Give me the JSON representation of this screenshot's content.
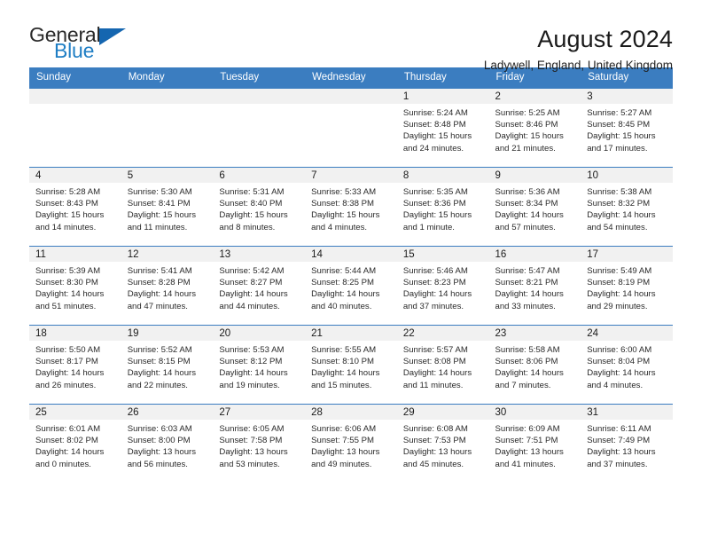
{
  "brand": {
    "name_part1": "General",
    "name_part2": "Blue",
    "accent_color": "#1f7ec4",
    "triangle_color": "#1566b0"
  },
  "header": {
    "title": "August 2024",
    "subtitle": "Ladywell, England, United Kingdom"
  },
  "calendar": {
    "header_bg": "#3b7dc0",
    "daynum_bg": "#f1f1f1",
    "weekdays": [
      "Sunday",
      "Monday",
      "Tuesday",
      "Wednesday",
      "Thursday",
      "Friday",
      "Saturday"
    ],
    "weeks": [
      [
        {
          "day": "",
          "empty": true
        },
        {
          "day": "",
          "empty": true
        },
        {
          "day": "",
          "empty": true
        },
        {
          "day": "",
          "empty": true
        },
        {
          "day": "1",
          "sunrise": "Sunrise: 5:24 AM",
          "sunset": "Sunset: 8:48 PM",
          "daylight": "Daylight: 15 hours and 24 minutes."
        },
        {
          "day": "2",
          "sunrise": "Sunrise: 5:25 AM",
          "sunset": "Sunset: 8:46 PM",
          "daylight": "Daylight: 15 hours and 21 minutes."
        },
        {
          "day": "3",
          "sunrise": "Sunrise: 5:27 AM",
          "sunset": "Sunset: 8:45 PM",
          "daylight": "Daylight: 15 hours and 17 minutes."
        }
      ],
      [
        {
          "day": "4",
          "sunrise": "Sunrise: 5:28 AM",
          "sunset": "Sunset: 8:43 PM",
          "daylight": "Daylight: 15 hours and 14 minutes."
        },
        {
          "day": "5",
          "sunrise": "Sunrise: 5:30 AM",
          "sunset": "Sunset: 8:41 PM",
          "daylight": "Daylight: 15 hours and 11 minutes."
        },
        {
          "day": "6",
          "sunrise": "Sunrise: 5:31 AM",
          "sunset": "Sunset: 8:40 PM",
          "daylight": "Daylight: 15 hours and 8 minutes."
        },
        {
          "day": "7",
          "sunrise": "Sunrise: 5:33 AM",
          "sunset": "Sunset: 8:38 PM",
          "daylight": "Daylight: 15 hours and 4 minutes."
        },
        {
          "day": "8",
          "sunrise": "Sunrise: 5:35 AM",
          "sunset": "Sunset: 8:36 PM",
          "daylight": "Daylight: 15 hours and 1 minute."
        },
        {
          "day": "9",
          "sunrise": "Sunrise: 5:36 AM",
          "sunset": "Sunset: 8:34 PM",
          "daylight": "Daylight: 14 hours and 57 minutes."
        },
        {
          "day": "10",
          "sunrise": "Sunrise: 5:38 AM",
          "sunset": "Sunset: 8:32 PM",
          "daylight": "Daylight: 14 hours and 54 minutes."
        }
      ],
      [
        {
          "day": "11",
          "sunrise": "Sunrise: 5:39 AM",
          "sunset": "Sunset: 8:30 PM",
          "daylight": "Daylight: 14 hours and 51 minutes."
        },
        {
          "day": "12",
          "sunrise": "Sunrise: 5:41 AM",
          "sunset": "Sunset: 8:28 PM",
          "daylight": "Daylight: 14 hours and 47 minutes."
        },
        {
          "day": "13",
          "sunrise": "Sunrise: 5:42 AM",
          "sunset": "Sunset: 8:27 PM",
          "daylight": "Daylight: 14 hours and 44 minutes."
        },
        {
          "day": "14",
          "sunrise": "Sunrise: 5:44 AM",
          "sunset": "Sunset: 8:25 PM",
          "daylight": "Daylight: 14 hours and 40 minutes."
        },
        {
          "day": "15",
          "sunrise": "Sunrise: 5:46 AM",
          "sunset": "Sunset: 8:23 PM",
          "daylight": "Daylight: 14 hours and 37 minutes."
        },
        {
          "day": "16",
          "sunrise": "Sunrise: 5:47 AM",
          "sunset": "Sunset: 8:21 PM",
          "daylight": "Daylight: 14 hours and 33 minutes."
        },
        {
          "day": "17",
          "sunrise": "Sunrise: 5:49 AM",
          "sunset": "Sunset: 8:19 PM",
          "daylight": "Daylight: 14 hours and 29 minutes."
        }
      ],
      [
        {
          "day": "18",
          "sunrise": "Sunrise: 5:50 AM",
          "sunset": "Sunset: 8:17 PM",
          "daylight": "Daylight: 14 hours and 26 minutes."
        },
        {
          "day": "19",
          "sunrise": "Sunrise: 5:52 AM",
          "sunset": "Sunset: 8:15 PM",
          "daylight": "Daylight: 14 hours and 22 minutes."
        },
        {
          "day": "20",
          "sunrise": "Sunrise: 5:53 AM",
          "sunset": "Sunset: 8:12 PM",
          "daylight": "Daylight: 14 hours and 19 minutes."
        },
        {
          "day": "21",
          "sunrise": "Sunrise: 5:55 AM",
          "sunset": "Sunset: 8:10 PM",
          "daylight": "Daylight: 14 hours and 15 minutes."
        },
        {
          "day": "22",
          "sunrise": "Sunrise: 5:57 AM",
          "sunset": "Sunset: 8:08 PM",
          "daylight": "Daylight: 14 hours and 11 minutes."
        },
        {
          "day": "23",
          "sunrise": "Sunrise: 5:58 AM",
          "sunset": "Sunset: 8:06 PM",
          "daylight": "Daylight: 14 hours and 7 minutes."
        },
        {
          "day": "24",
          "sunrise": "Sunrise: 6:00 AM",
          "sunset": "Sunset: 8:04 PM",
          "daylight": "Daylight: 14 hours and 4 minutes."
        }
      ],
      [
        {
          "day": "25",
          "sunrise": "Sunrise: 6:01 AM",
          "sunset": "Sunset: 8:02 PM",
          "daylight": "Daylight: 14 hours and 0 minutes."
        },
        {
          "day": "26",
          "sunrise": "Sunrise: 6:03 AM",
          "sunset": "Sunset: 8:00 PM",
          "daylight": "Daylight: 13 hours and 56 minutes."
        },
        {
          "day": "27",
          "sunrise": "Sunrise: 6:05 AM",
          "sunset": "Sunset: 7:58 PM",
          "daylight": "Daylight: 13 hours and 53 minutes."
        },
        {
          "day": "28",
          "sunrise": "Sunrise: 6:06 AM",
          "sunset": "Sunset: 7:55 PM",
          "daylight": "Daylight: 13 hours and 49 minutes."
        },
        {
          "day": "29",
          "sunrise": "Sunrise: 6:08 AM",
          "sunset": "Sunset: 7:53 PM",
          "daylight": "Daylight: 13 hours and 45 minutes."
        },
        {
          "day": "30",
          "sunrise": "Sunrise: 6:09 AM",
          "sunset": "Sunset: 7:51 PM",
          "daylight": "Daylight: 13 hours and 41 minutes."
        },
        {
          "day": "31",
          "sunrise": "Sunrise: 6:11 AM",
          "sunset": "Sunset: 7:49 PM",
          "daylight": "Daylight: 13 hours and 37 minutes."
        }
      ]
    ]
  }
}
